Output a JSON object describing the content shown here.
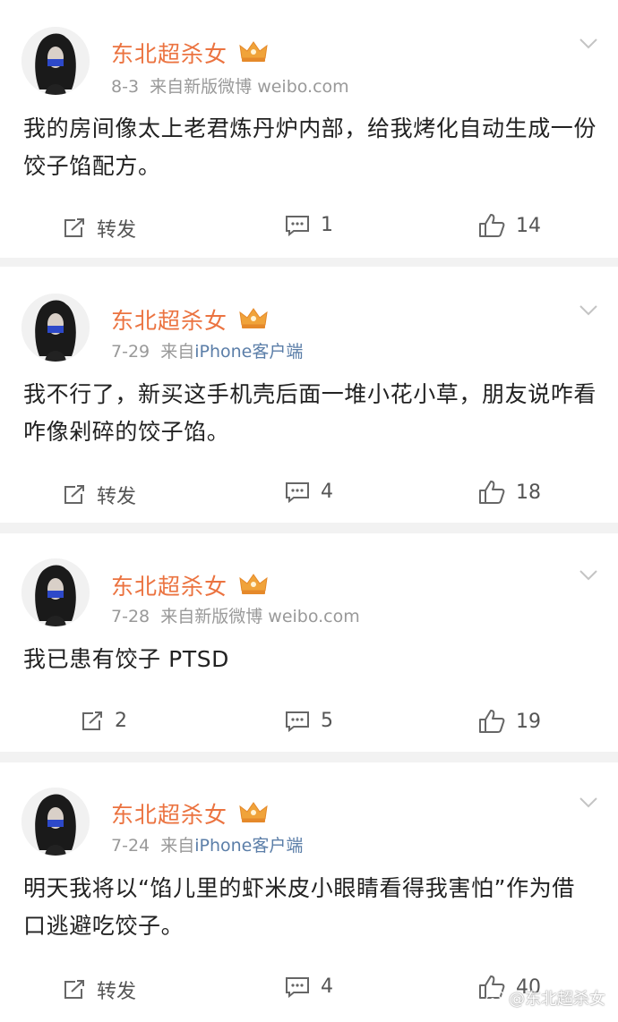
{
  "accent": "#eb7340",
  "link_color": "#5b7ea8",
  "posts": [
    {
      "username": "东北超杀女",
      "date": "8-3",
      "source_prefix": "来自",
      "source": "新版微博 weibo.com",
      "source_is_link": false,
      "text": "我的房间像太上老君炼丹炉内部，给我烤化自动生成一份饺子馅配方。",
      "repost": "转发",
      "comments": "1",
      "likes": "14"
    },
    {
      "username": "东北超杀女",
      "date": "7-29",
      "source_prefix": "来自",
      "source": "iPhone客户端",
      "source_is_link": true,
      "text": "我不行了，新买这手机壳后面一堆小花小草，朋友说咋看咋像剁碎的饺子馅。",
      "repost": "转发",
      "comments": "4",
      "likes": "18"
    },
    {
      "username": "东北超杀女",
      "date": "7-28",
      "source_prefix": "来自",
      "source": "新版微博 weibo.com",
      "source_is_link": false,
      "text": "我已患有饺子 PTSD",
      "repost": "2",
      "comments": "5",
      "likes": "19"
    },
    {
      "username": "东北超杀女",
      "date": "7-24",
      "source_prefix": "来自",
      "source": "iPhone客户端",
      "source_is_link": true,
      "text": "明天我将以“馅儿里的虾米皮小眼睛看得我害怕”作为借口逃避吃饺子。",
      "repost": "转发",
      "comments": "4",
      "likes": "40"
    }
  ],
  "watermark": "@东北超杀女",
  "icons": {
    "repost": "repost-icon",
    "comment": "comment-icon",
    "like": "thumbs-up-icon",
    "menu": "chevron-down-icon",
    "badge": "crown-badge-icon",
    "watermark": "weibo-logo-icon"
  }
}
